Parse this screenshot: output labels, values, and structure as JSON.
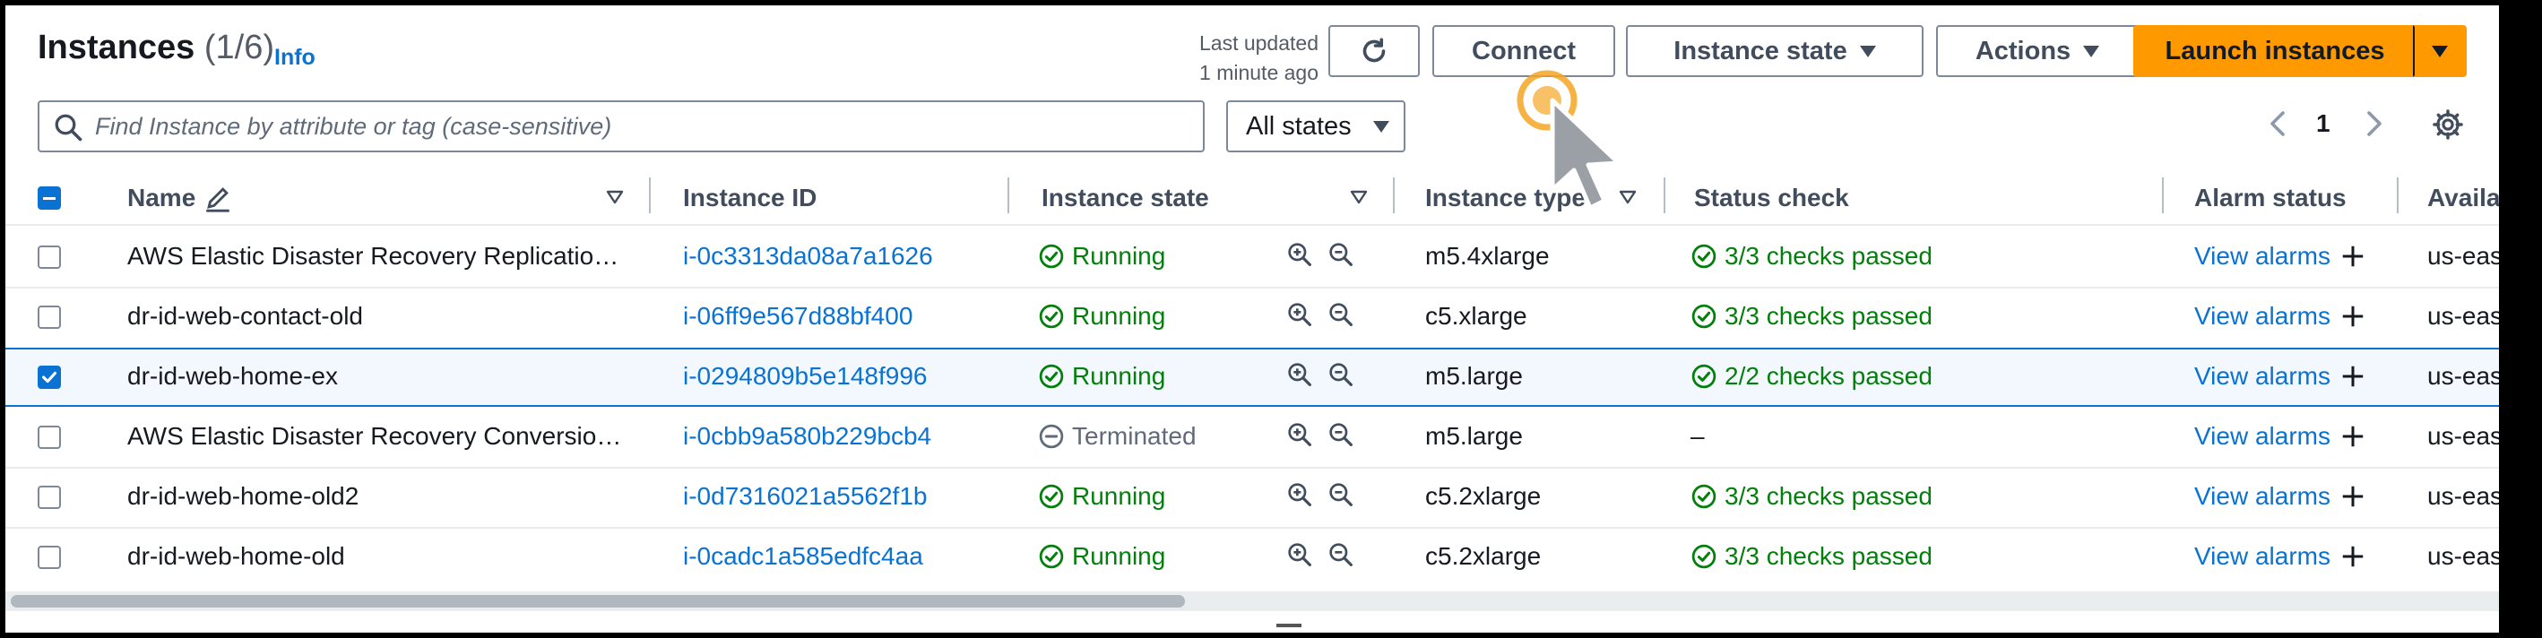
{
  "header": {
    "title": "Instances",
    "count": "(1/6)",
    "info": "Info",
    "last_updated_line1": "Last updated",
    "last_updated_line2": "1 minute ago"
  },
  "toolbar": {
    "connect": "Connect",
    "instance_state": "Instance state",
    "actions": "Actions",
    "launch": "Launch instances",
    "refresh_icon": "refresh-icon",
    "settings_icon": "gear-icon"
  },
  "filter": {
    "placeholder": "Find Instance by attribute or tag (case-sensitive)",
    "states": "All states"
  },
  "pagination": {
    "page": "1"
  },
  "columns": {
    "name": "Name",
    "instance_id": "Instance ID",
    "instance_state": "Instance state",
    "instance_type": "Instance type",
    "status_check": "Status check",
    "alarm_status": "Alarm status",
    "availability": "Availab"
  },
  "rows": [
    {
      "name": "AWS Elastic Disaster Recovery Replicatio…",
      "id": "i-0c3313da08a7a1626",
      "state": "Running",
      "type": "m5.4xlarge",
      "status": "3/3 checks passed",
      "alarm": "View alarms",
      "az": "us-east",
      "selected": false
    },
    {
      "name": "dr-id-web-contact-old",
      "id": "i-06ff9e567d88bf400",
      "state": "Running",
      "type": "c5.xlarge",
      "status": "3/3 checks passed",
      "alarm": "View alarms",
      "az": "us-east",
      "selected": false
    },
    {
      "name": "dr-id-web-home-ex",
      "id": "i-0294809b5e148f996",
      "state": "Running",
      "type": "m5.large",
      "status": "2/2 checks passed",
      "alarm": "View alarms",
      "az": "us-east",
      "selected": true
    },
    {
      "name": "AWS Elastic Disaster Recovery Conversio…",
      "id": "i-0cbb9a580b229bcb4",
      "state": "Terminated",
      "type": "m5.large",
      "status": "–",
      "alarm": "View alarms",
      "az": "us-east",
      "selected": false
    },
    {
      "name": "dr-id-web-home-old2",
      "id": "i-0d7316021a5562f1b",
      "state": "Running",
      "type": "c5.2xlarge",
      "status": "3/3 checks passed",
      "alarm": "View alarms",
      "az": "us-east",
      "selected": false
    },
    {
      "name": "dr-id-web-home-old",
      "id": "i-0cadc1a585edfc4aa",
      "state": "Running",
      "type": "c5.2xlarge",
      "status": "3/3 checks passed",
      "alarm": "View alarms",
      "az": "us-east",
      "selected": false
    }
  ],
  "colors": {
    "link": "#0972d3",
    "running": "#037f0c",
    "primary": "#ff9900"
  }
}
